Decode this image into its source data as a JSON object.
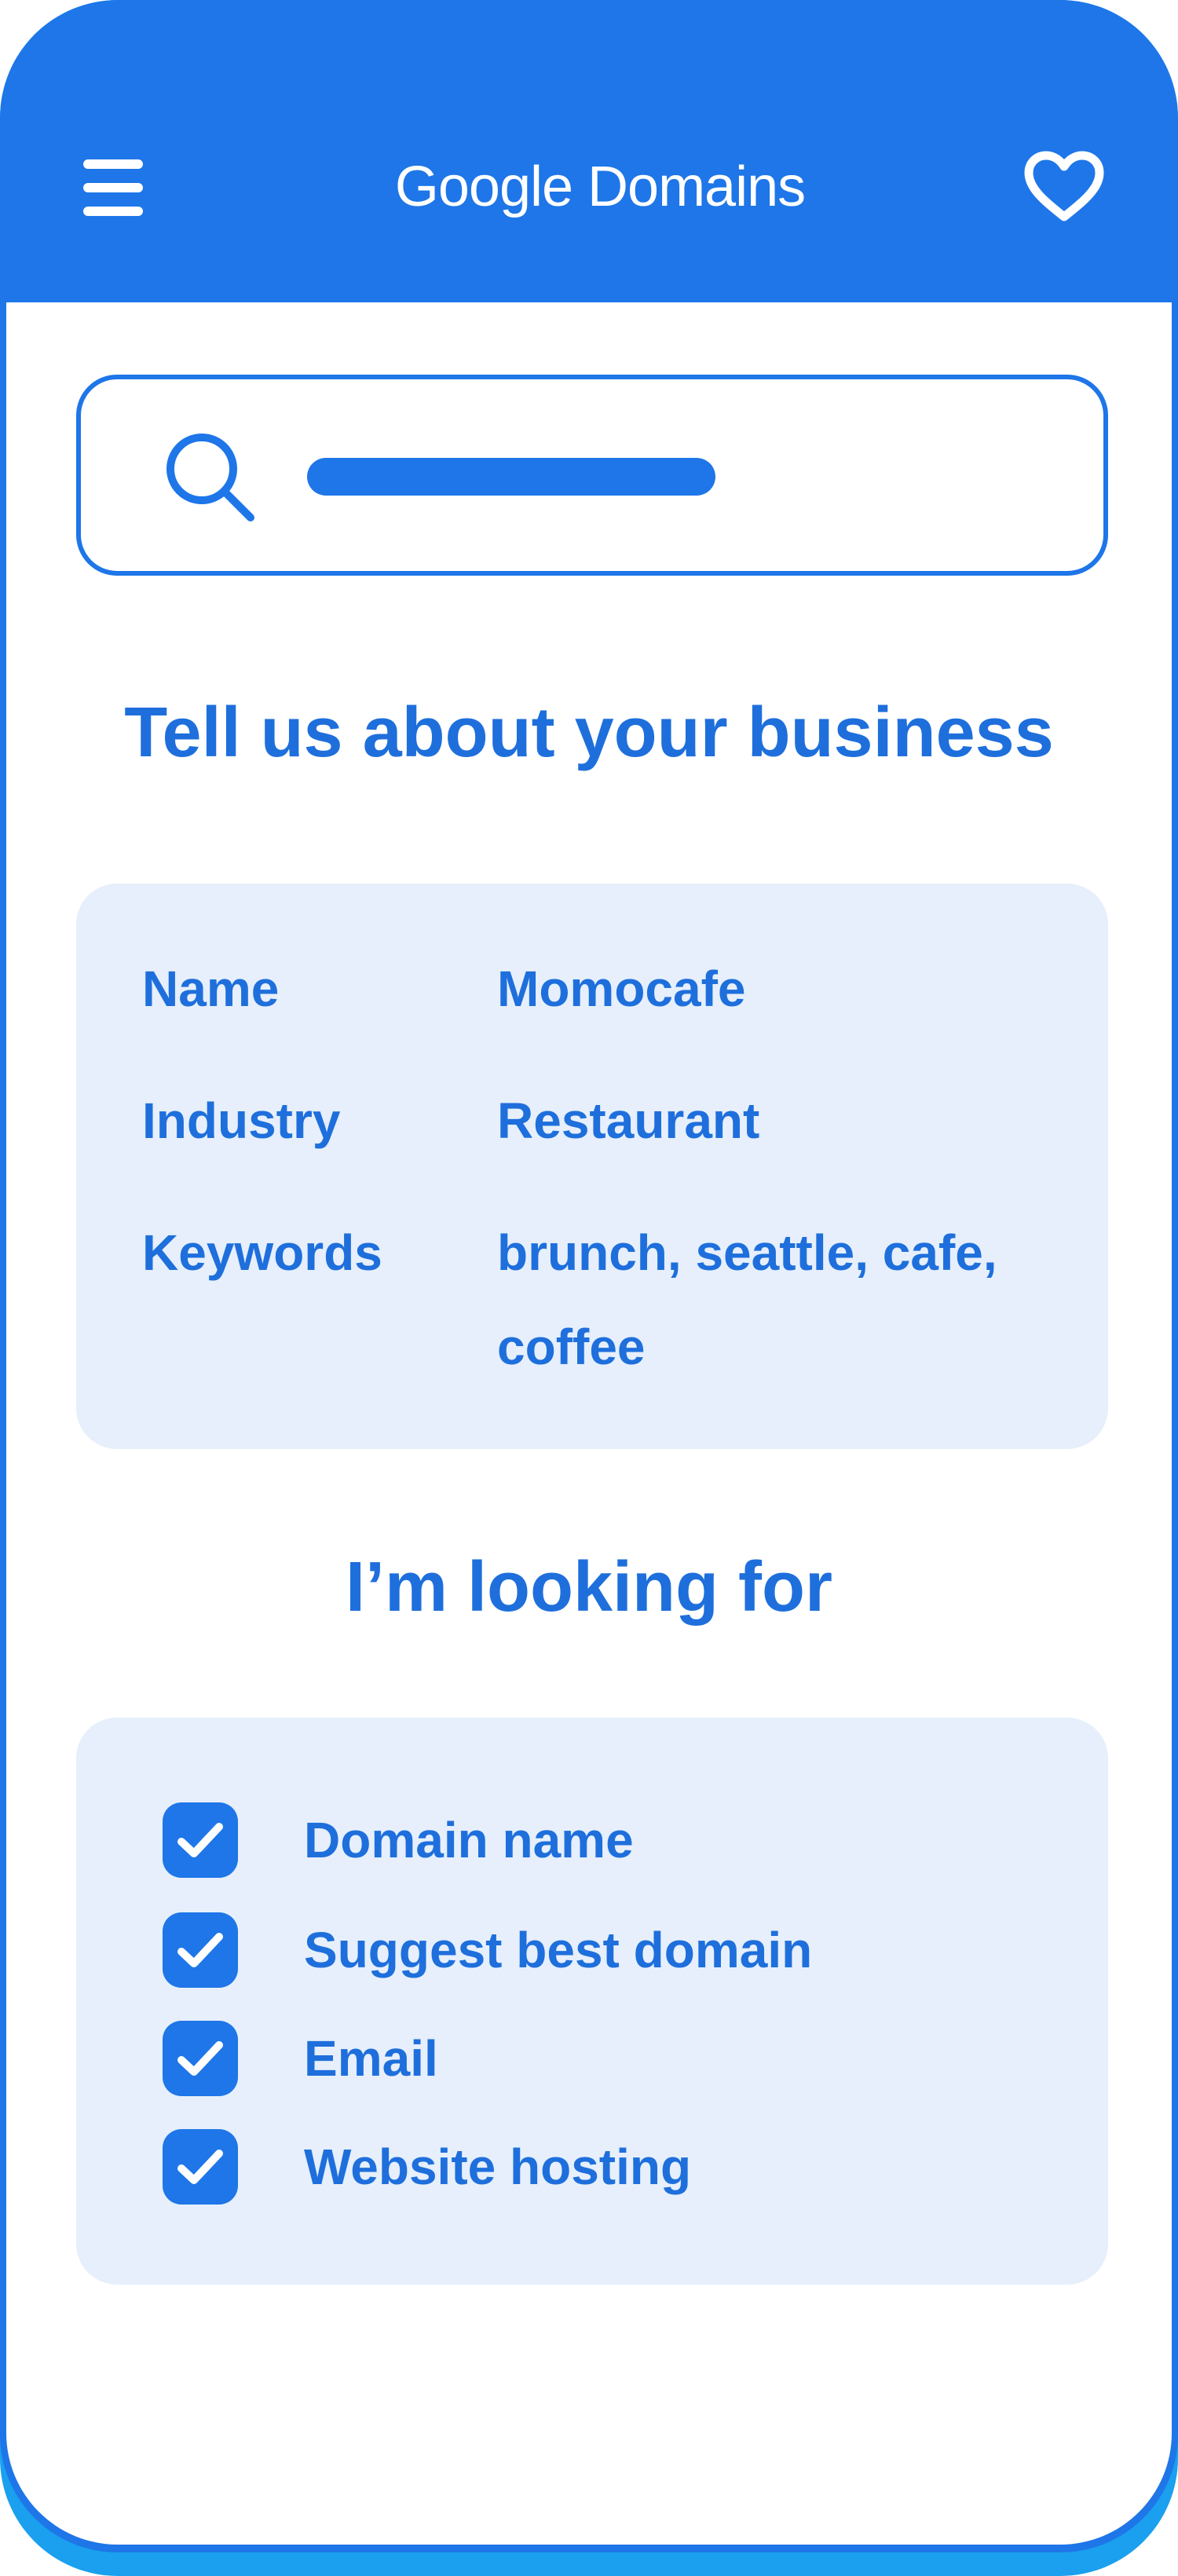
{
  "header": {
    "title": "Google Domains",
    "menu_icon": "hamburger-menu-icon",
    "favorite_icon": "heart-icon"
  },
  "search": {
    "icon": "search-icon",
    "placeholder_shown_as_bar": true
  },
  "business_section": {
    "title": "Tell us about your business",
    "fields": [
      {
        "label": "Name",
        "value": "Momocafe"
      },
      {
        "label": "Industry",
        "value": "Restaurant"
      },
      {
        "label": "Keywords",
        "value": "brunch, seattle, cafe, coffee"
      }
    ]
  },
  "looking_for_section": {
    "title": "I’m looking for",
    "options": [
      {
        "label": "Domain name",
        "checked": true
      },
      {
        "label": "Suggest best domain",
        "checked": true
      },
      {
        "label": "Email",
        "checked": true
      },
      {
        "label": "Website hosting",
        "checked": true
      }
    ]
  },
  "colors": {
    "primary": "#1e76e8",
    "text_blue": "#1e6fdc",
    "card_background": "#e6effb",
    "bottom_edge": "#1aa0ee"
  }
}
